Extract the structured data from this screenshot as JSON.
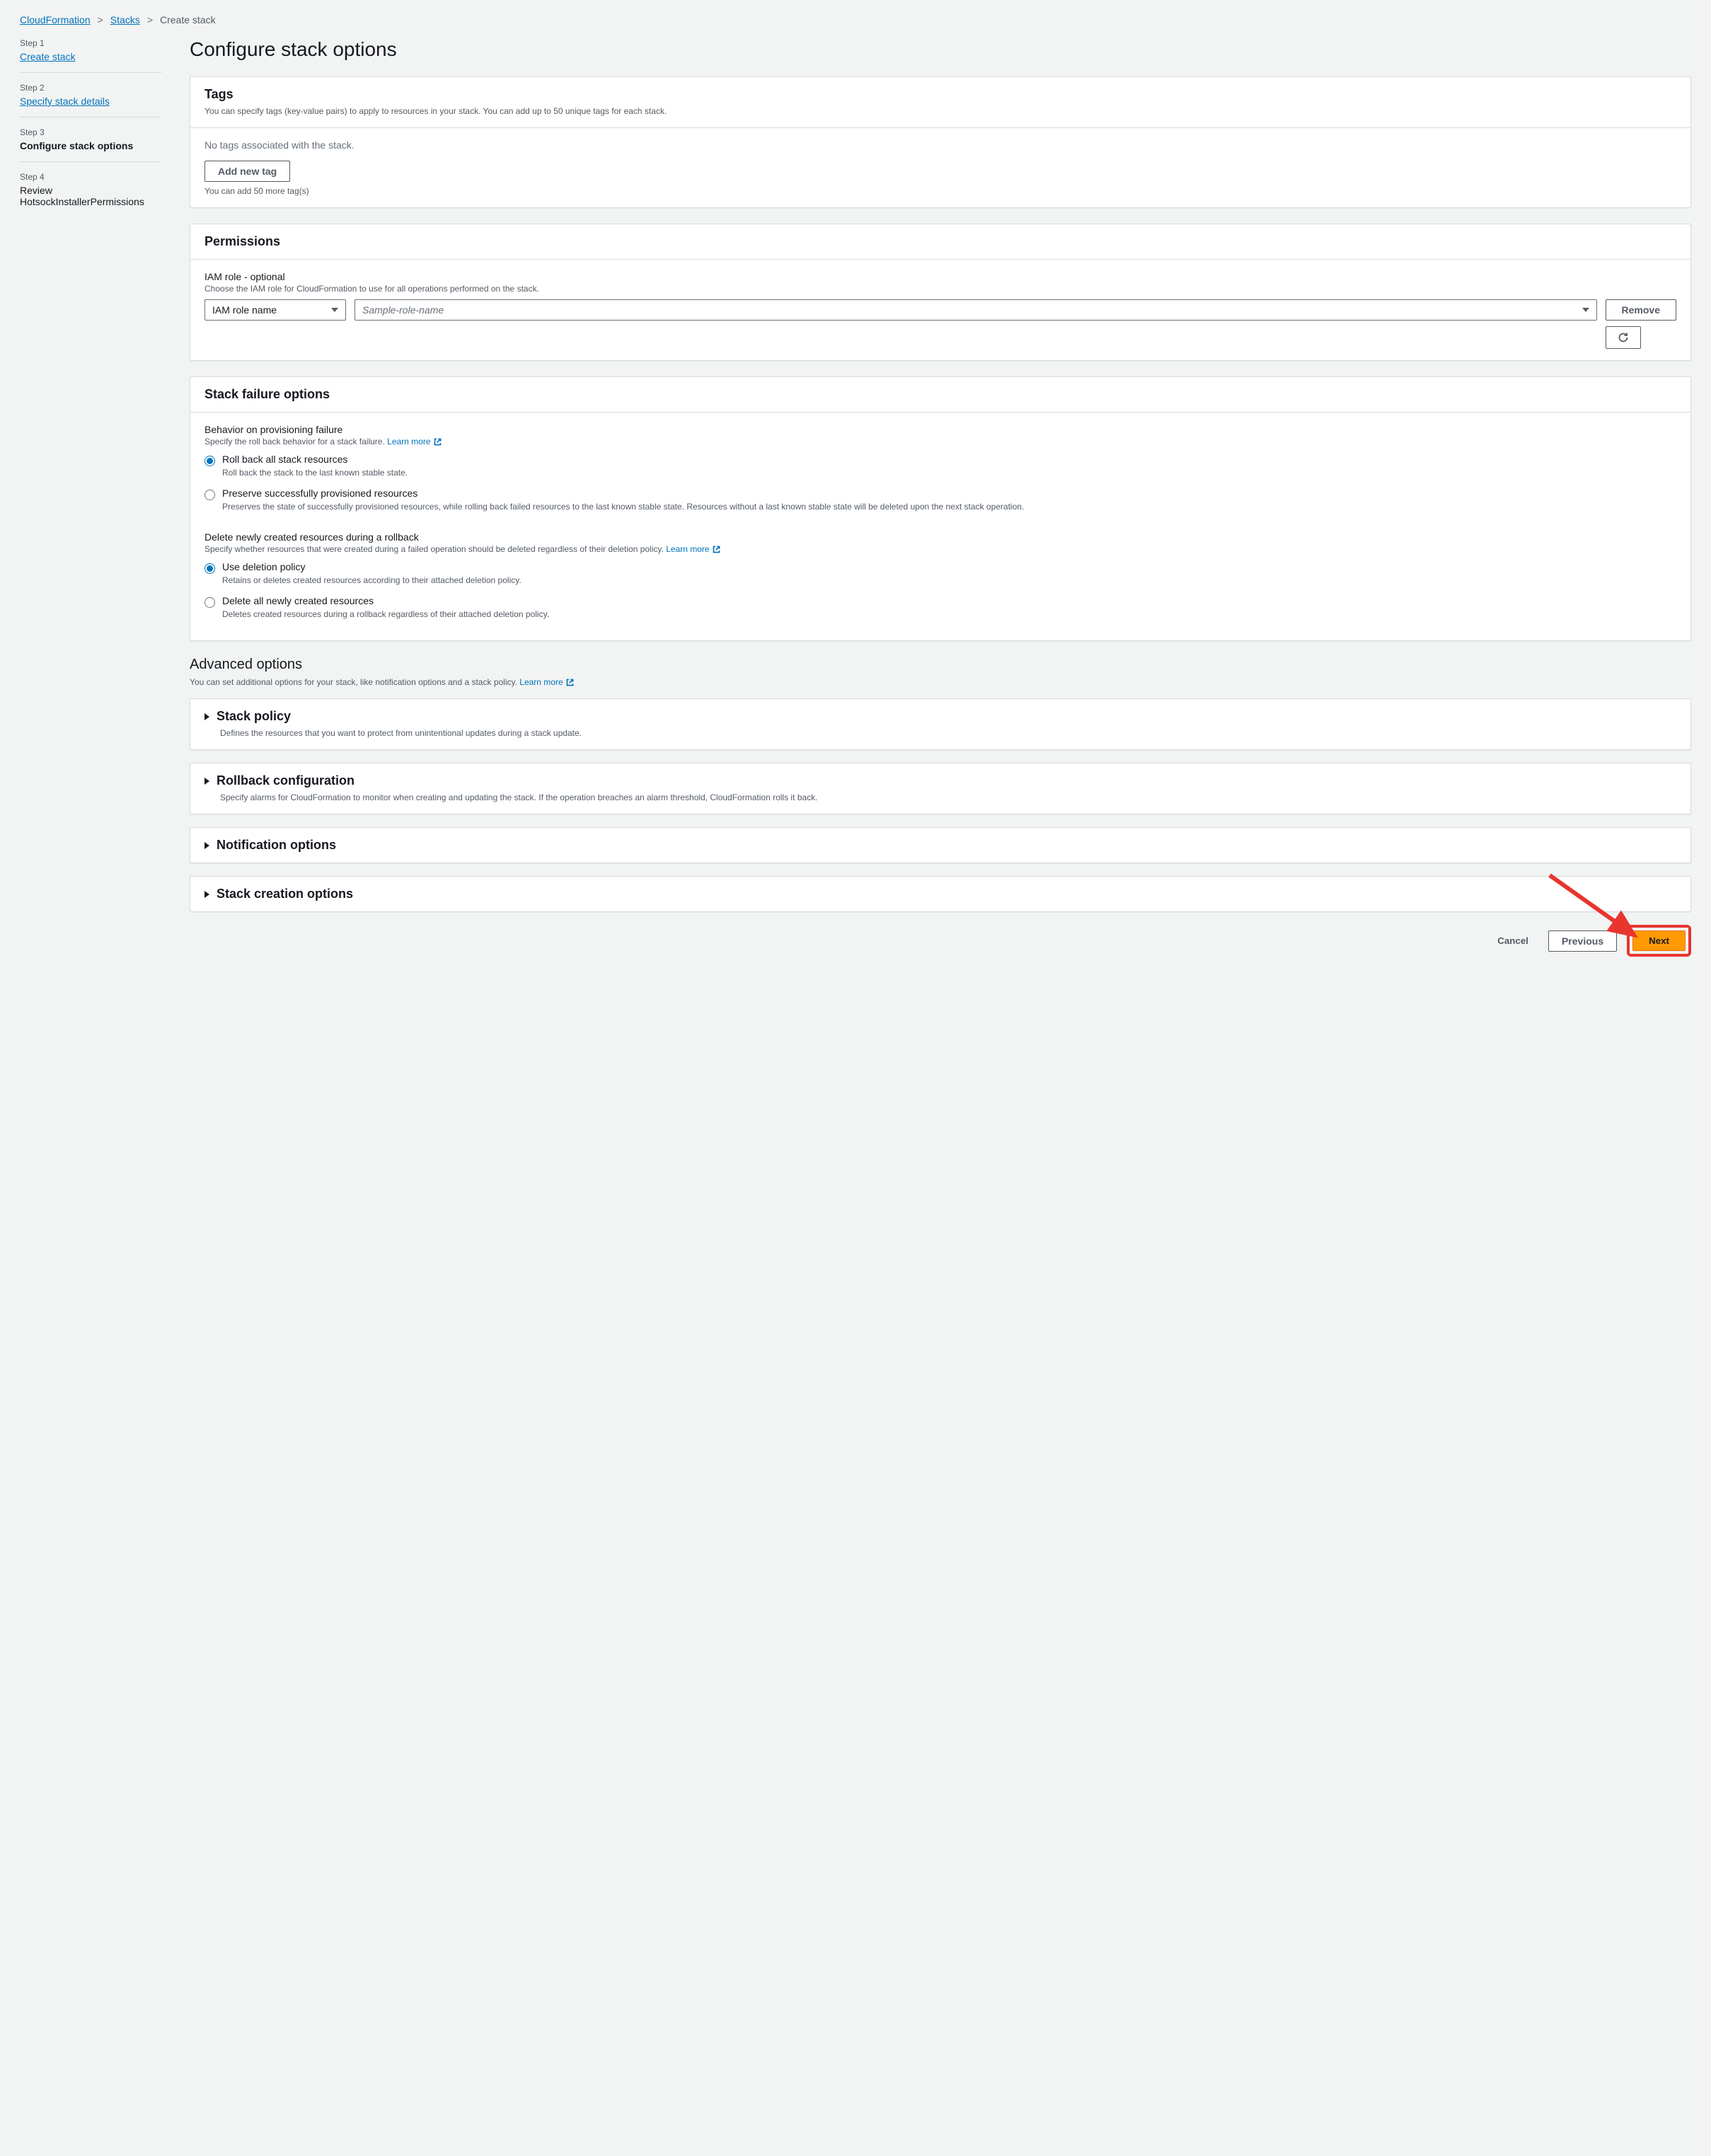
{
  "breadcrumbs": {
    "items": [
      "CloudFormation",
      "Stacks",
      "Create stack"
    ]
  },
  "steps": [
    {
      "label": "Step 1",
      "title": "Create stack",
      "link": true
    },
    {
      "label": "Step 2",
      "title": "Specify stack details",
      "link": true
    },
    {
      "label": "Step 3",
      "title": "Configure stack options",
      "current": true
    },
    {
      "label": "Step 4",
      "title": "Review HotsockInstallerPermissions"
    }
  ],
  "page_title": "Configure stack options",
  "tags": {
    "title": "Tags",
    "desc": "You can specify tags (key-value pairs) to apply to resources in your stack. You can add up to 50 unique tags for each stack.",
    "empty": "No tags associated with the stack.",
    "add_btn": "Add new tag",
    "limit": "You can add 50 more tag(s)"
  },
  "permissions": {
    "title": "Permissions",
    "field_label": "IAM role - optional",
    "field_desc": "Choose the IAM role for CloudFormation to use for all operations performed on the stack.",
    "select1_value": "IAM role name",
    "select2_placeholder": "Sample-role-name",
    "remove": "Remove"
  },
  "failure": {
    "title": "Stack failure options",
    "prov_title": "Behavior on provisioning failure",
    "prov_desc": "Specify the roll back behavior for a stack failure.",
    "learn_more": "Learn more",
    "prov_options": [
      {
        "label": "Roll back all stack resources",
        "desc": "Roll back the stack to the last known stable state.",
        "checked": true
      },
      {
        "label": "Preserve successfully provisioned resources",
        "desc": "Preserves the state of successfully provisioned resources, while rolling back failed resources to the last known stable state. Resources without a last known stable state will be deleted upon the next stack operation."
      }
    ],
    "del_title": "Delete newly created resources during a rollback",
    "del_desc": "Specify whether resources that were created during a failed operation should be deleted regardless of their deletion policy.",
    "del_options": [
      {
        "label": "Use deletion policy",
        "desc": "Retains or deletes created resources according to their attached deletion policy.",
        "checked": true
      },
      {
        "label": "Delete all newly created resources",
        "desc": "Deletes created resources during a rollback regardless of their attached deletion policy."
      }
    ]
  },
  "advanced": {
    "title": "Advanced options",
    "desc": "You can set additional options for your stack, like notification options and a stack policy.",
    "learn_more": "Learn more"
  },
  "expanders": [
    {
      "title": "Stack policy",
      "desc": "Defines the resources that you want to protect from unintentional updates during a stack update."
    },
    {
      "title": "Rollback configuration",
      "desc": "Specify alarms for CloudFormation to monitor when creating and updating the stack. If the operation breaches an alarm threshold, CloudFormation rolls it back."
    },
    {
      "title": "Notification options"
    },
    {
      "title": "Stack creation options"
    }
  ],
  "footer": {
    "cancel": "Cancel",
    "previous": "Previous",
    "next": "Next"
  }
}
